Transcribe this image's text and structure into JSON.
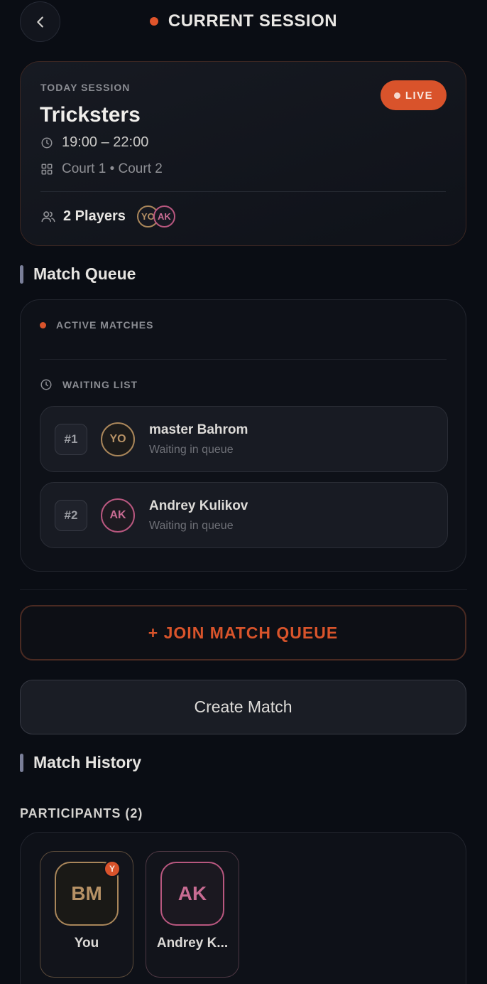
{
  "header": {
    "title": "CURRENT SESSION",
    "back_icon": "chevron-left-icon",
    "status_dot_color": "#e0542b"
  },
  "session": {
    "eyebrow": "TODAY SESSION",
    "name": "Tricksters",
    "live_label": "LIVE",
    "time": "19:00 – 22:00",
    "courts": "Court 1 • Court 2",
    "players_label": "2 Players",
    "player_initials": [
      "YO",
      "AK"
    ],
    "accent_color": "#d9532b"
  },
  "queue": {
    "section_title": "Match Queue",
    "active_label": "ACTIVE MATCHES",
    "waiting_label": "WAITING LIST",
    "items": [
      {
        "rank": "#1",
        "initials": "YO",
        "name": "master Bahrom",
        "status": "Waiting in queue"
      },
      {
        "rank": "#2",
        "initials": "AK",
        "name": "Andrey Kulikov",
        "status": "Waiting in queue"
      }
    ]
  },
  "actions": {
    "join_label": "+ JOIN MATCH QUEUE",
    "create_label": "Create Match"
  },
  "history": {
    "section_title": "Match History"
  },
  "participants": {
    "label": "PARTICIPANTS (2)",
    "items": [
      {
        "initials": "BM",
        "name": "You",
        "badge": "Y"
      },
      {
        "initials": "AK",
        "name": "Andrey K..."
      }
    ]
  }
}
